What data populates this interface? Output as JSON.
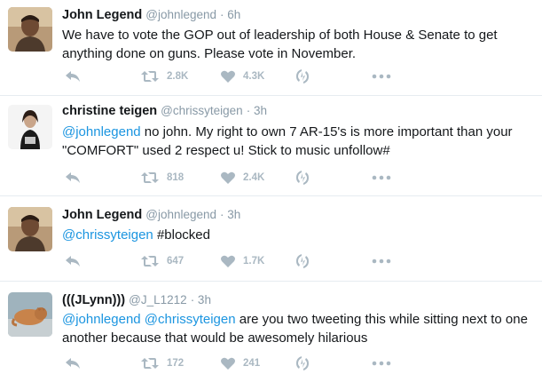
{
  "colors": {
    "mention": "#1b95e0",
    "meta": "#8899a6",
    "action": "#aab8c2",
    "divider": "#e6ecf0"
  },
  "tweets": [
    {
      "name": "John Legend",
      "handle": "@johnlegend",
      "time": "· 6h",
      "text": "We have to vote the GOP out of leadership of both House & Senate to get anything done on guns.  Please vote in November.",
      "retweets": "2.8K",
      "likes": "4.3K"
    },
    {
      "name": "christine teigen",
      "handle": "@chrissyteigen",
      "time": "· 3h",
      "mention": "@johnlegend",
      "text": " no john. My right to own 7 AR-15's is more important than your \"COMFORT\" used 2 respect u! Stick to music unfollow#",
      "retweets": "818",
      "likes": "2.4K"
    },
    {
      "name": "John Legend",
      "handle": "@johnlegend",
      "time": "· 3h",
      "mention": "@chrissyteigen",
      "text": " #blocked",
      "retweets": "647",
      "likes": "1.7K"
    },
    {
      "name": "(((JLynn)))",
      "handle": "@J_L1212",
      "time": "· 3h",
      "mention": "@johnlegend @chrissyteigen",
      "text": " are you two tweeting this while sitting next to one another because that would be awesomely hilarious",
      "retweets": "172",
      "likes": "241"
    }
  ]
}
